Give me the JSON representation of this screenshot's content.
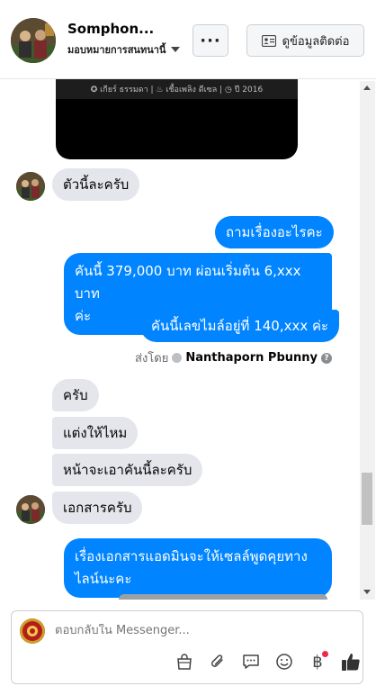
{
  "header": {
    "name": "Somphon...",
    "assign_label": "มอบหมายการสนทนานี้",
    "more_label": "···",
    "contact_label": "ดูข้อมูลติดต่อ"
  },
  "video": {
    "caption": "✪ เกียร์ ธรรมดา  |  ♨ เชื้อเพลิง ดีเซล  |  ◷ ปี 2016"
  },
  "messages": {
    "in1": "ตัวนี้ละครับ",
    "out1": "ถามเรื่องอะไรคะ",
    "out2_line1": "คันนี้ 379,000 บาท ผ่อนเริ่มต้น 6,xxx บาท",
    "out2_line2": "ค่ะ",
    "out3": "คันนี้เลขไมล์อยู่ที่ 140,xxx ค่ะ",
    "sent_by_prefix": "ส่งโดย",
    "sent_by_name": "Nanthaporn Pbunny",
    "in2": "ครับ",
    "in3": "แต่งให้ไหม",
    "in4": "หน้าจะเอาคันนี้ละครับ",
    "in5": "เอกสารครับ",
    "out4_line1": "เรื่องเอกสารแอดมินจะให้เซลล์พูดคุยทาง",
    "out4_line2": "ไลน์นะคะ"
  },
  "composer": {
    "placeholder": "ตอบกลับใน Messenger...",
    "baht_symbol": "฿"
  },
  "colors": {
    "outgoing": "#0084ff",
    "incoming": "#e4e6eb"
  }
}
